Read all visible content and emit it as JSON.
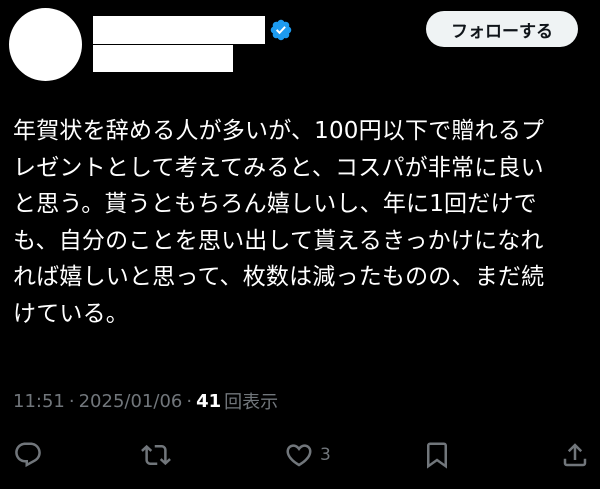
{
  "header": {
    "follow_label": "フォローする"
  },
  "tweet": {
    "text": "年賀状を辞める人が多いが、100円以下で贈れるプ\nレゼントとして考えてみると、コスパが非常に良い\nと思う。貰うともちろん嬉しいし、年に1回だけで\nも、自分のことを思い出して貰えるきっかけになれ\nれば嬉しいと思って、枚数は減ったものの、まだ続\nけている。",
    "time": "11:51",
    "separator1": "·",
    "date": "2025/01/06",
    "separator2": "·",
    "views_count": "41",
    "views_label": "回表示"
  },
  "actions": {
    "like_count": "3"
  },
  "colors": {
    "background": "#000000",
    "text": "#ffffff",
    "muted": "#71767b",
    "verified_badge": "#1d9bf0",
    "follow_button_bg": "#eff3f4"
  },
  "icons": [
    "verified-badge-icon",
    "reply-icon",
    "retweet-icon",
    "like-icon",
    "bookmark-icon",
    "share-icon"
  ]
}
